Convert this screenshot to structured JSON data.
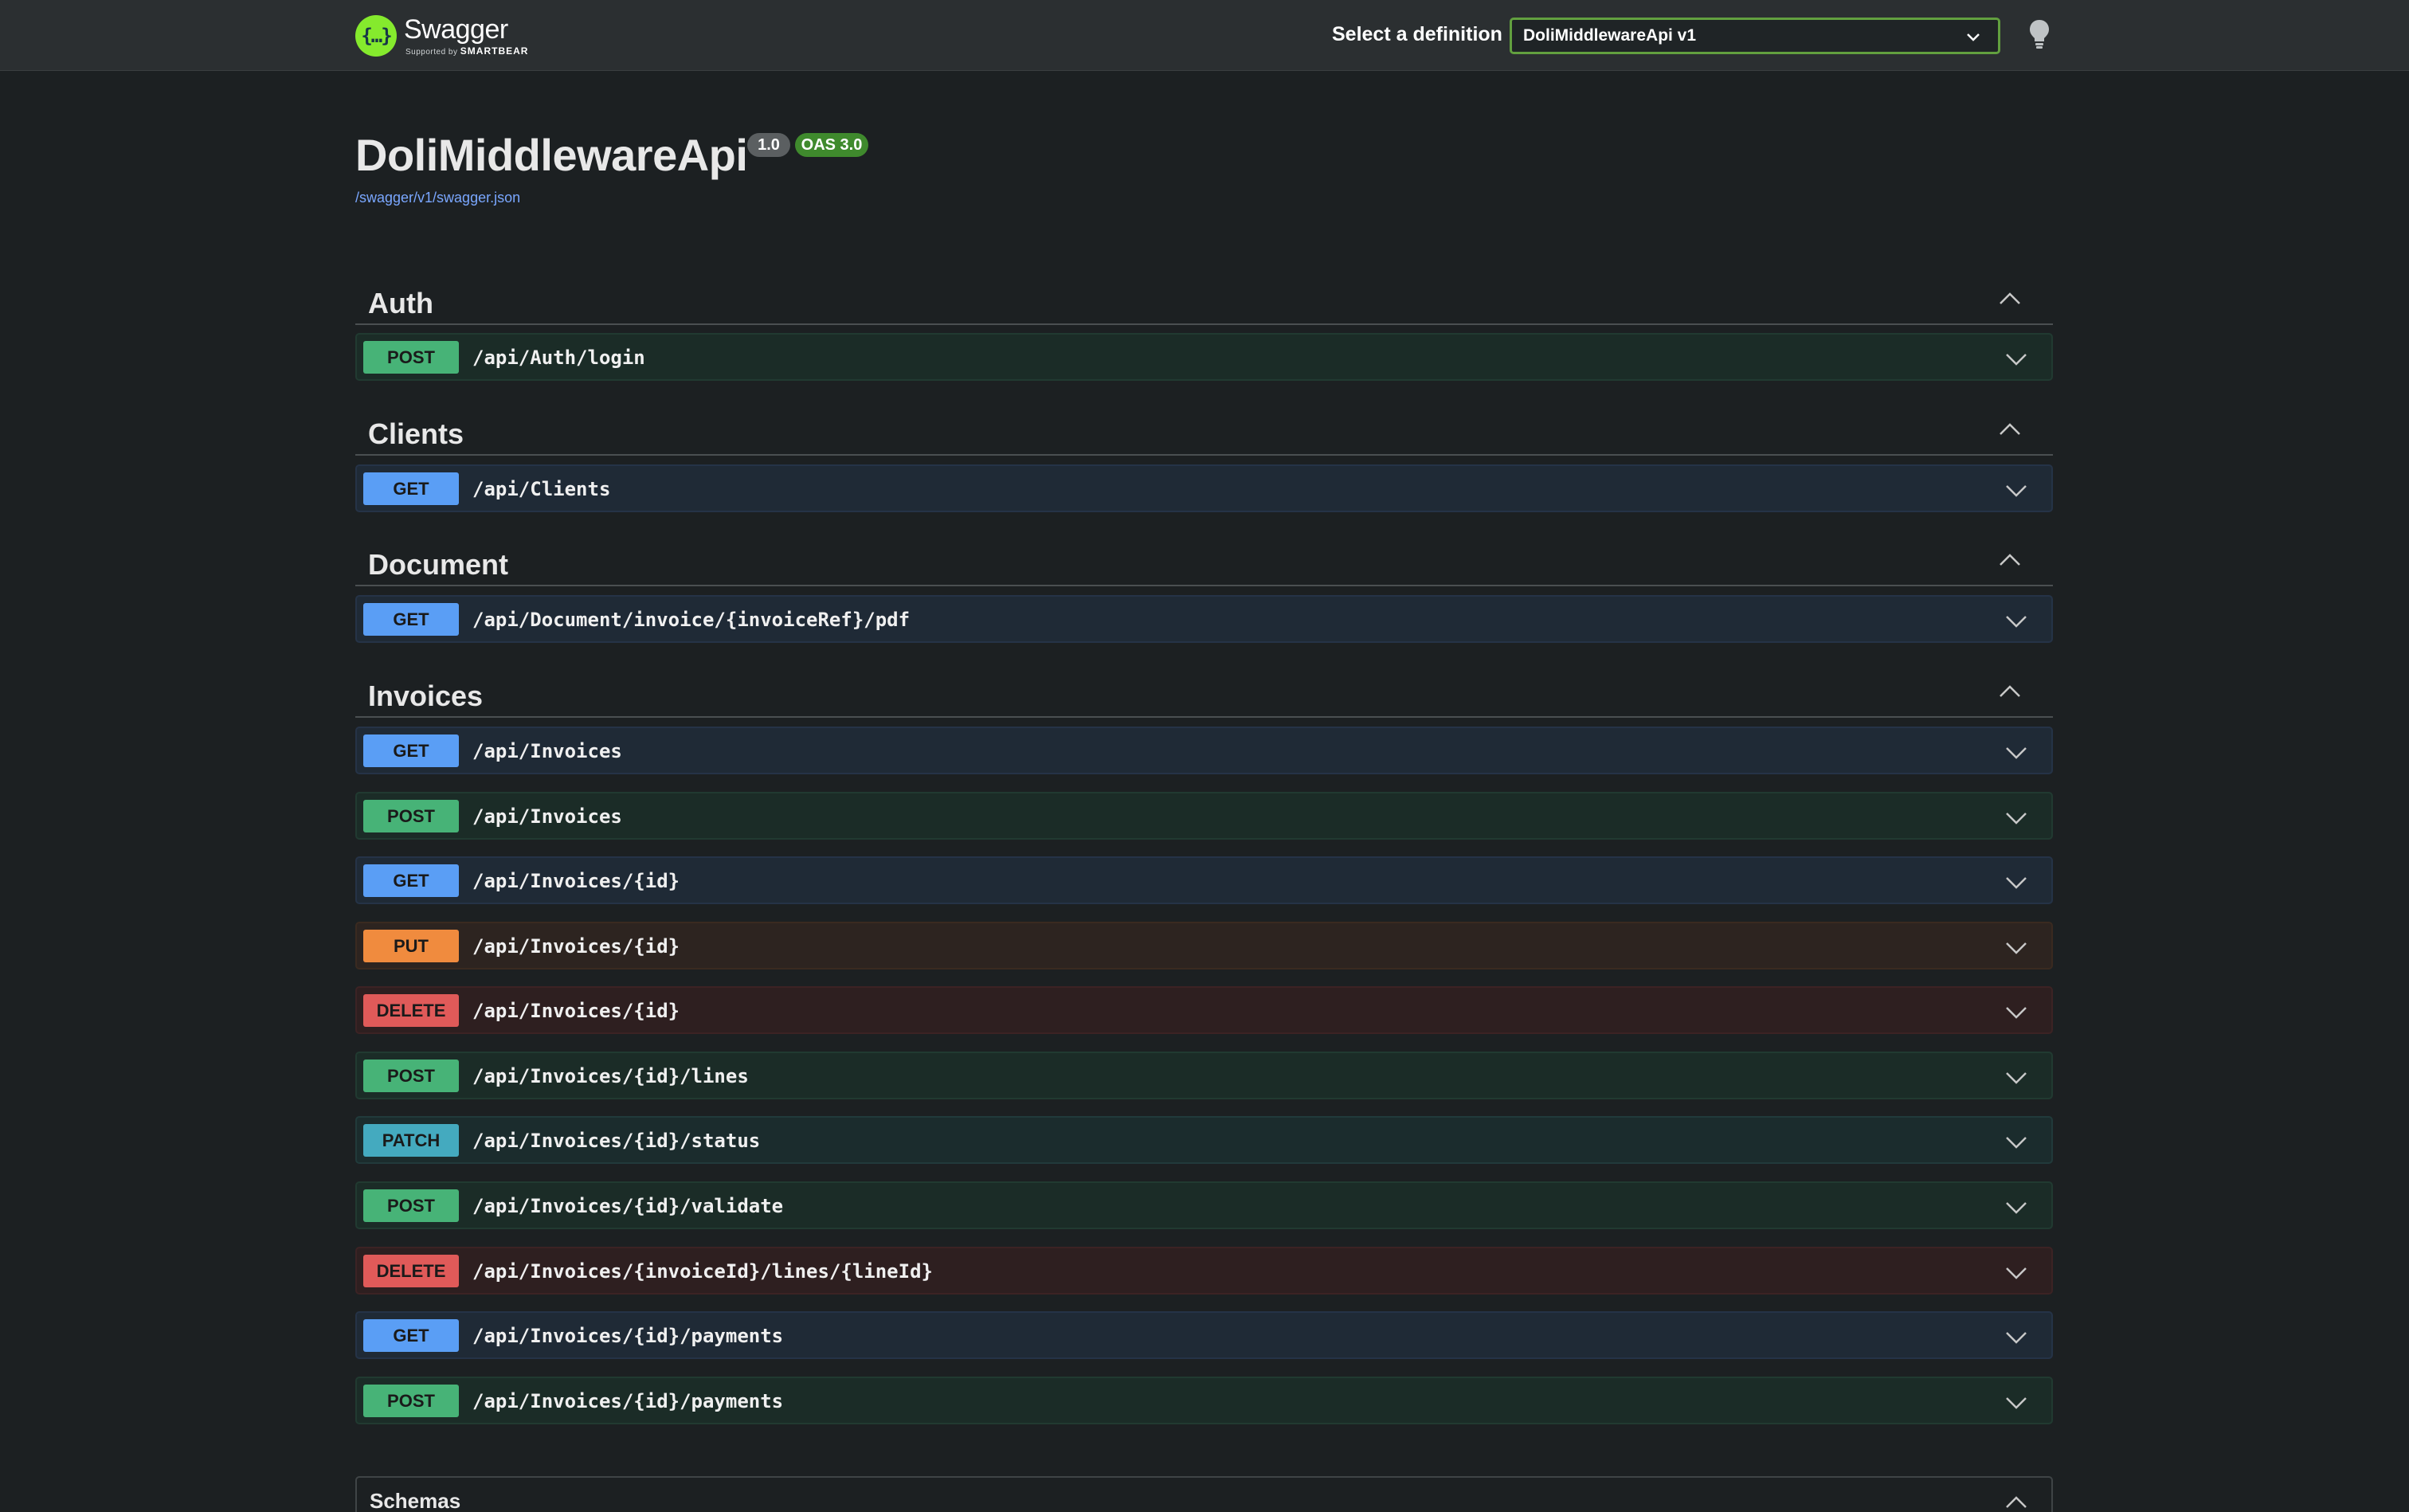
{
  "topbar": {
    "logo_name": "Swagger",
    "logo_sub_prefix": "Supported by",
    "logo_sub_brand": "SMARTBEAR",
    "definition_label": "Select a definition",
    "definition_selected": "DoliMiddlewareApi v1"
  },
  "info": {
    "title": "DoliMiddlewareApi",
    "version": "1.0",
    "oas": "OAS 3.0",
    "spec_link": "/swagger/v1/swagger.json"
  },
  "sections": [
    {
      "name": "Auth",
      "operations": [
        {
          "method": "POST",
          "path": "/api/Auth/login"
        }
      ]
    },
    {
      "name": "Clients",
      "operations": [
        {
          "method": "GET",
          "path": "/api/Clients"
        }
      ]
    },
    {
      "name": "Document",
      "operations": [
        {
          "method": "GET",
          "path": "/api/Document/invoice/{invoiceRef}/pdf"
        }
      ]
    },
    {
      "name": "Invoices",
      "operations": [
        {
          "method": "GET",
          "path": "/api/Invoices"
        },
        {
          "method": "POST",
          "path": "/api/Invoices"
        },
        {
          "method": "GET",
          "path": "/api/Invoices/{id}"
        },
        {
          "method": "PUT",
          "path": "/api/Invoices/{id}"
        },
        {
          "method": "DELETE",
          "path": "/api/Invoices/{id}"
        },
        {
          "method": "POST",
          "path": "/api/Invoices/{id}/lines"
        },
        {
          "method": "PATCH",
          "path": "/api/Invoices/{id}/status"
        },
        {
          "method": "POST",
          "path": "/api/Invoices/{id}/validate"
        },
        {
          "method": "DELETE",
          "path": "/api/Invoices/{invoiceId}/lines/{lineId}"
        },
        {
          "method": "GET",
          "path": "/api/Invoices/{id}/payments"
        },
        {
          "method": "POST",
          "path": "/api/Invoices/{id}/payments"
        }
      ]
    }
  ],
  "schemas": {
    "title": "Schemas"
  },
  "colors": {
    "get": "#5a9ef5",
    "post": "#47b377",
    "put": "#f08b3e",
    "delete": "#e05a59",
    "patch": "#44aabf",
    "accent": "#85ea2d"
  }
}
